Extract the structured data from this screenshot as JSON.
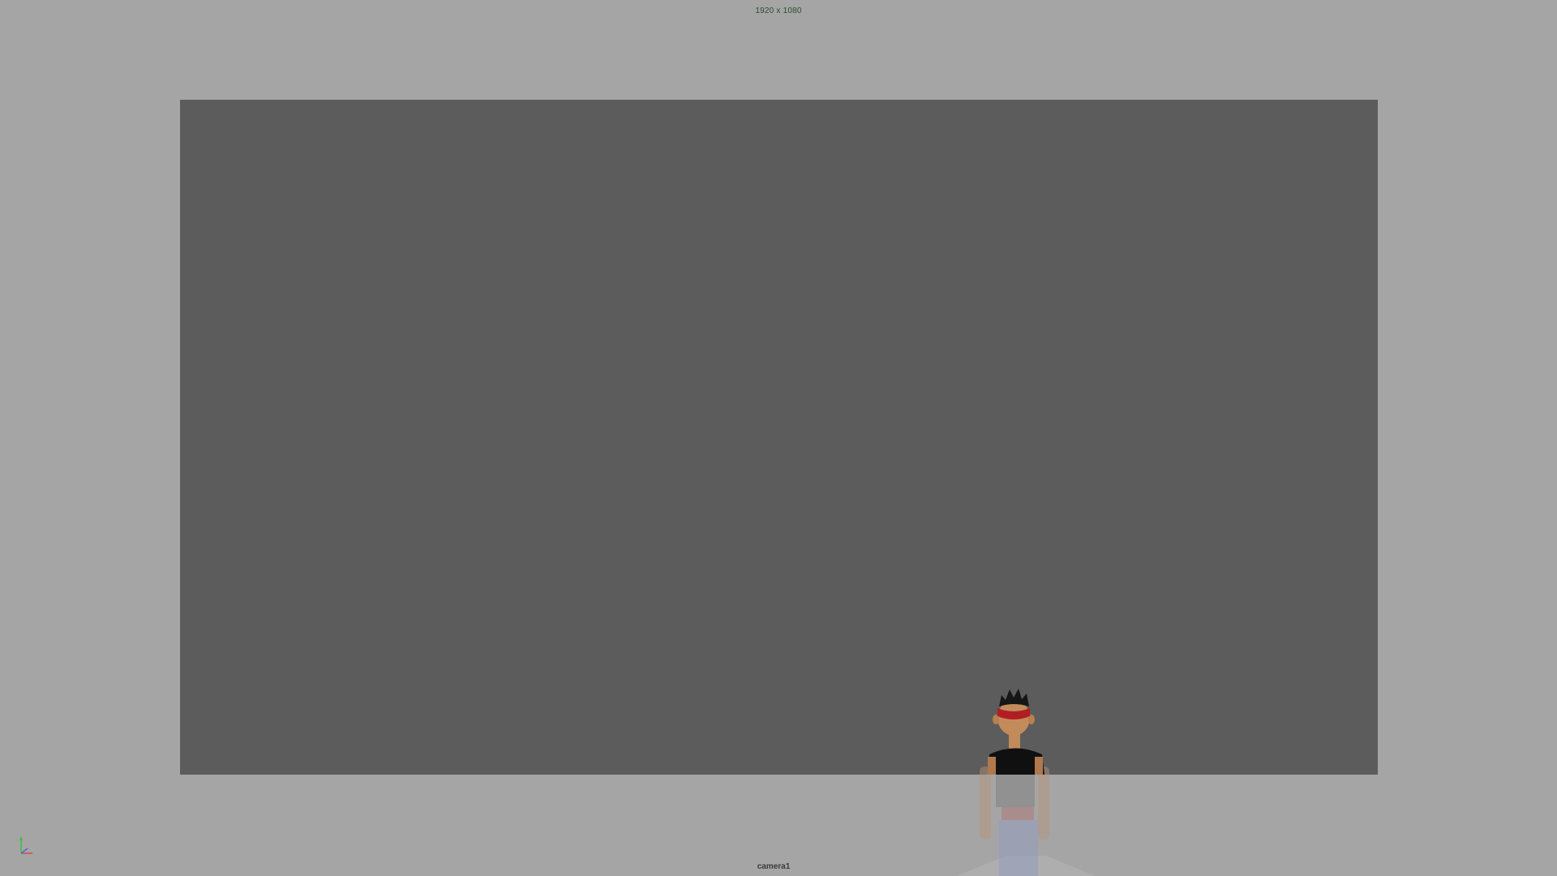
{
  "viewport": {
    "resolution_label": "1920 x 1080",
    "camera_label": "camera1"
  },
  "colors": {
    "viewport_background": "#a5a5a5",
    "resolution_gate": "#5c5c5c",
    "resolution_label_text": "#2f4a2f",
    "camera_label_text": "#3a3a3a"
  },
  "icons": {
    "axis_gizmo": "axis-gizmo-icon",
    "character": "character-model"
  }
}
